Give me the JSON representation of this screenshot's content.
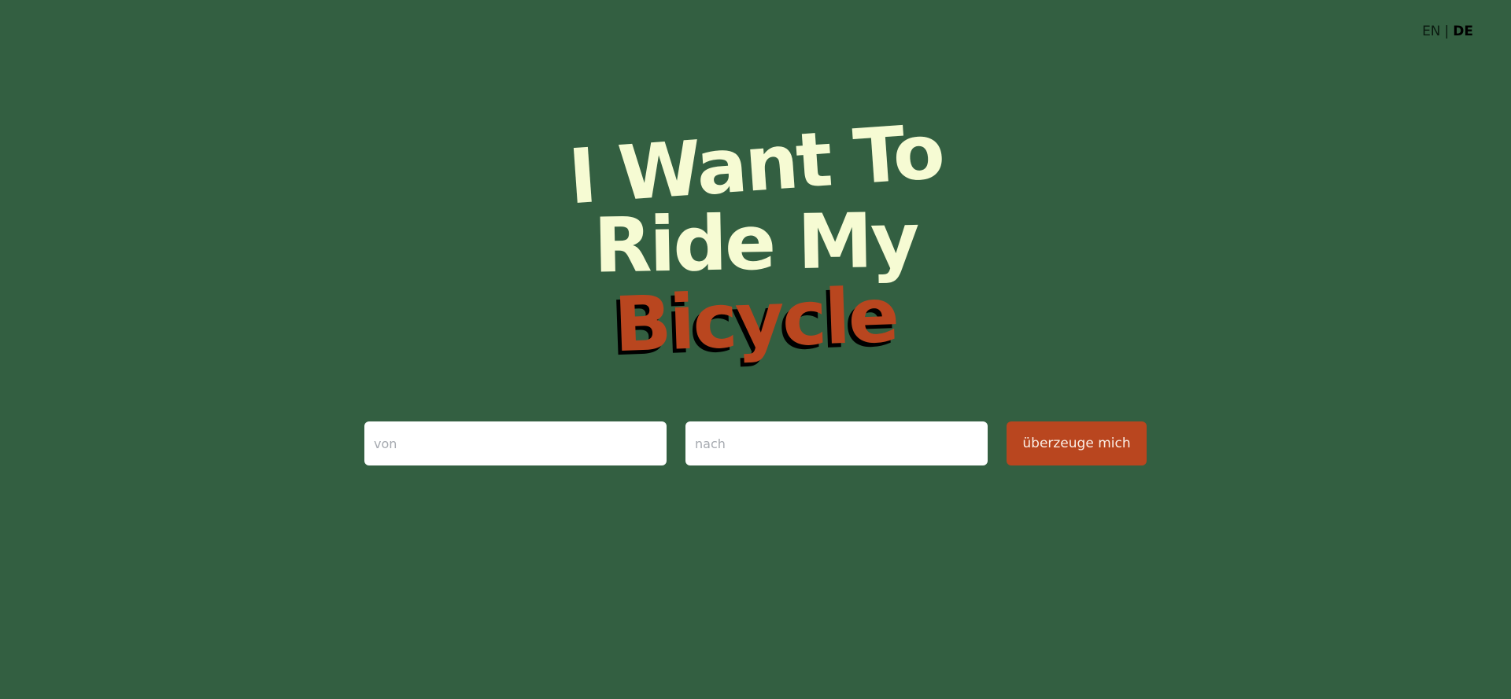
{
  "language_switch": {
    "en_label": "EN",
    "separator": "|",
    "de_label": "DE",
    "active": "DE"
  },
  "hero": {
    "line1": "I Want To",
    "line2": "Ride My",
    "line3": "Bicycle"
  },
  "form": {
    "from_placeholder": "von",
    "from_value": "",
    "to_placeholder": "nach",
    "to_value": "",
    "submit_label": "überzeuge mich"
  },
  "colors": {
    "background": "#335f41",
    "headline": "#f6fbd3",
    "accent": "#b9461f",
    "shadow": "#000000"
  }
}
